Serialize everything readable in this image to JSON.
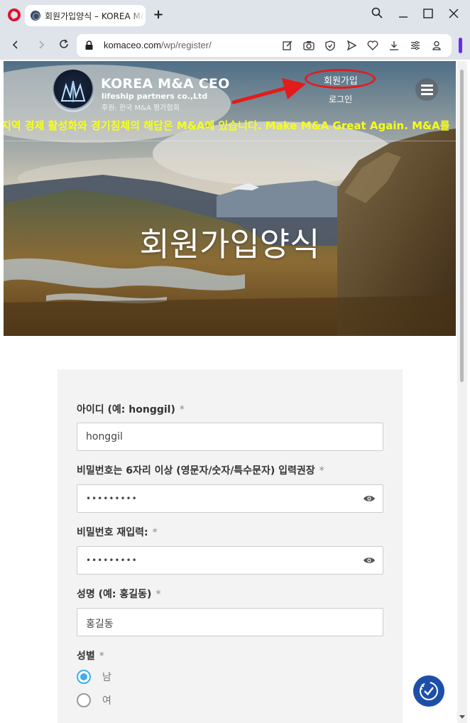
{
  "browser": {
    "tab_title": "회원가입양식 – KOREA M&A CEO",
    "new_tab_symbol": "+",
    "url_host": "komaceo.com",
    "url_path": "/wp/register/",
    "window_controls": [
      "search-icon",
      "minimize-icon",
      "maximize-icon",
      "close-icon"
    ],
    "toolbar_icons": [
      "edit-icon",
      "camera-icon",
      "shield-icon",
      "send-icon",
      "heart-icon",
      "download-icon",
      "tabs-icon",
      "profile-icon"
    ],
    "accent_color": "#6a2cf5"
  },
  "site": {
    "brand_title": "KOREA M&A CEO",
    "brand_subtitle": "lifeship partners co.,Ltd",
    "brand_sponsor": "후원: 한국 M&A 평가협회",
    "nav_signup": "회원가입",
    "nav_login": "로그인",
    "ticker": "지역 경제 활성화와 경기침체의 해답은 M&A에 있습니다. Make M&A Great Again. M&A를",
    "hero_title": "회원가입양식",
    "ticker_color": "#f7ff1a",
    "highlight_color": "#e41b1b"
  },
  "form": {
    "username_label": "아이디 (예: honggil)",
    "username_value": "honggil",
    "password_label": "비밀번호는 6자리 이상 (영문자/숫자/특수문자) 입력권장",
    "password_value": "•••••••••",
    "password_confirm_label": "비밀번호 재입력:",
    "password_confirm_value": "•••••••••",
    "name_label": "성명 (예: 홍길동)",
    "name_value": "홍길동",
    "gender_label": "성별",
    "gender_options": [
      "남",
      "여"
    ],
    "gender_selected": "남",
    "required_mark": "*",
    "accent_color": "#3daee9"
  }
}
